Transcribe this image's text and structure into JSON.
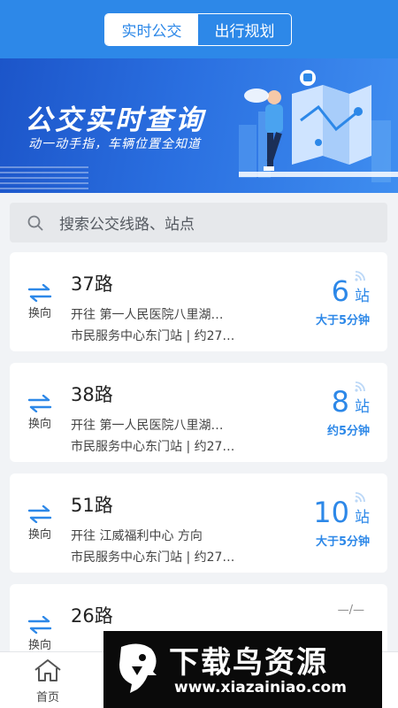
{
  "tabs": {
    "realtime": "实时公交",
    "planning": "出行规划"
  },
  "banner": {
    "title": "公交实时查询",
    "subtitle": "动一动手指，车辆位置全知道"
  },
  "search": {
    "placeholder": "搜索公交线路、站点"
  },
  "routes": [
    {
      "name": "37路",
      "direction": "开往 第一人民医院八里湖…",
      "station": "市民服务中心东门站 | 约27…",
      "eta_stops": "6",
      "eta_unit": "站",
      "eta_time": "大于5分钟",
      "swap": "换向"
    },
    {
      "name": "38路",
      "direction": "开往 第一人民医院八里湖…",
      "station": "市民服务中心东门站 | 约27…",
      "eta_stops": "8",
      "eta_unit": "站",
      "eta_time": "约5分钟",
      "swap": "换向"
    },
    {
      "name": "51路",
      "direction": "开往 江威福利中心 方向",
      "station": "市民服务中心东门站 | 约27…",
      "eta_stops": "10",
      "eta_unit": "站",
      "eta_time": "大于5分钟",
      "swap": "换向"
    },
    {
      "name": "26路",
      "eta_stops": "—/—",
      "swap": "换向"
    }
  ],
  "tabbar": {
    "home": "首页"
  },
  "watermark": {
    "brand": "下载鸟资源",
    "url": "www.xiazainiao.com"
  },
  "colors": {
    "primary": "#2d88e8",
    "banner_dark": "#1c55c9"
  }
}
